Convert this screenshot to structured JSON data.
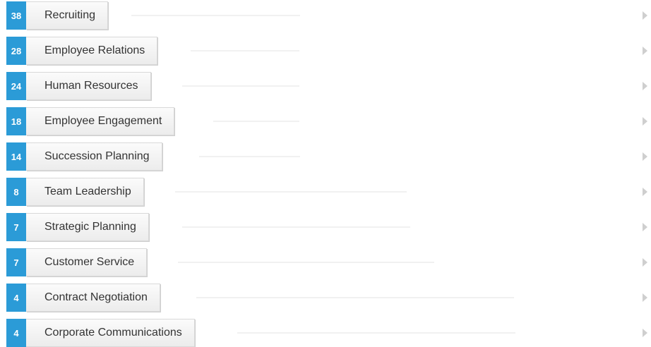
{
  "skills": [
    {
      "count": "38",
      "label": "Recruiting"
    },
    {
      "count": "28",
      "label": "Employee Relations"
    },
    {
      "count": "24",
      "label": "Human Resources"
    },
    {
      "count": "18",
      "label": "Employee Engagement"
    },
    {
      "count": "14",
      "label": "Succession Planning"
    },
    {
      "count": "8",
      "label": "Team Leadership"
    },
    {
      "count": "7",
      "label": "Strategic Planning"
    },
    {
      "count": "7",
      "label": "Customer Service"
    },
    {
      "count": "4",
      "label": "Contract Negotiation"
    },
    {
      "count": "4",
      "label": "Corporate Communications"
    }
  ],
  "colors": {
    "badge": "#2b9bd7",
    "pill_border": "#d9d9d9",
    "bar": "#f1f1f1",
    "arrow": "#cfcfcf"
  },
  "icons": {
    "row_action": "chevron-right-icon"
  }
}
